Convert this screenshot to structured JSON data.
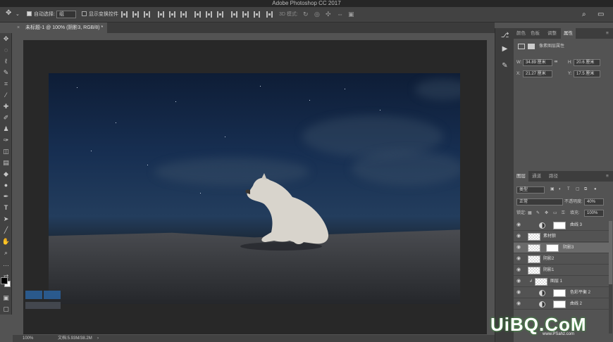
{
  "app": {
    "title": "Adobe Photoshop CC 2017"
  },
  "options_bar": {
    "auto_select_label": "自动选择:",
    "auto_select_value": "组",
    "show_transform_label": "显示变换控件",
    "mode_3d_label": "3D 模式:"
  },
  "document": {
    "tab_title": "未标题-1 @ 100% (阴影3, RGB/8) *",
    "close_glyph": "×"
  },
  "status_bar": {
    "zoom": "100%",
    "doc_size": "文档:5.93M/38.2M"
  },
  "panel_top": {
    "tabs": [
      "颜色",
      "色板",
      "调整",
      "属性"
    ],
    "active_tab": "属性",
    "properties_title": "像素图层属性",
    "w_label": "W:",
    "w_value": "34.89 厘米",
    "h_label": "H:",
    "h_value": "20.6 厘米",
    "x_label": "X:",
    "x_value": "21.27 厘米",
    "y_label": "Y:",
    "y_value": "17.5 厘米"
  },
  "panel_layers": {
    "tabs": [
      "图层",
      "通道",
      "路径"
    ],
    "active_tab": "图层",
    "filter_kind": "类型",
    "blend_mode": "正常",
    "opacity_label": "不透明度:",
    "opacity_value": "40%",
    "lock_label": "锁定:",
    "fill_label": "填充:",
    "fill_value": "100%",
    "layers": [
      {
        "name": "曲线 3",
        "kind": "adjustment",
        "selected": false
      },
      {
        "name": "素材狼",
        "kind": "group",
        "selected": false
      },
      {
        "name": "阴影3",
        "kind": "pixel-masked",
        "selected": true
      },
      {
        "name": "阴影2",
        "kind": "pixel",
        "selected": false
      },
      {
        "name": "阴影1",
        "kind": "pixel",
        "selected": false
      },
      {
        "name": "图层 1",
        "kind": "pixel-clipped",
        "selected": false
      },
      {
        "name": "色彩平衡 2",
        "kind": "adjustment",
        "selected": false
      },
      {
        "name": "曲线 2",
        "kind": "adjustment",
        "selected": false
      }
    ]
  },
  "watermark": {
    "brand": "UiBQ.CoM",
    "brand_sub": "www.PSahz.com"
  },
  "colors": {
    "chrome_dark": "#262626",
    "panel": "#535353",
    "canvas_sky": "#172f52"
  }
}
